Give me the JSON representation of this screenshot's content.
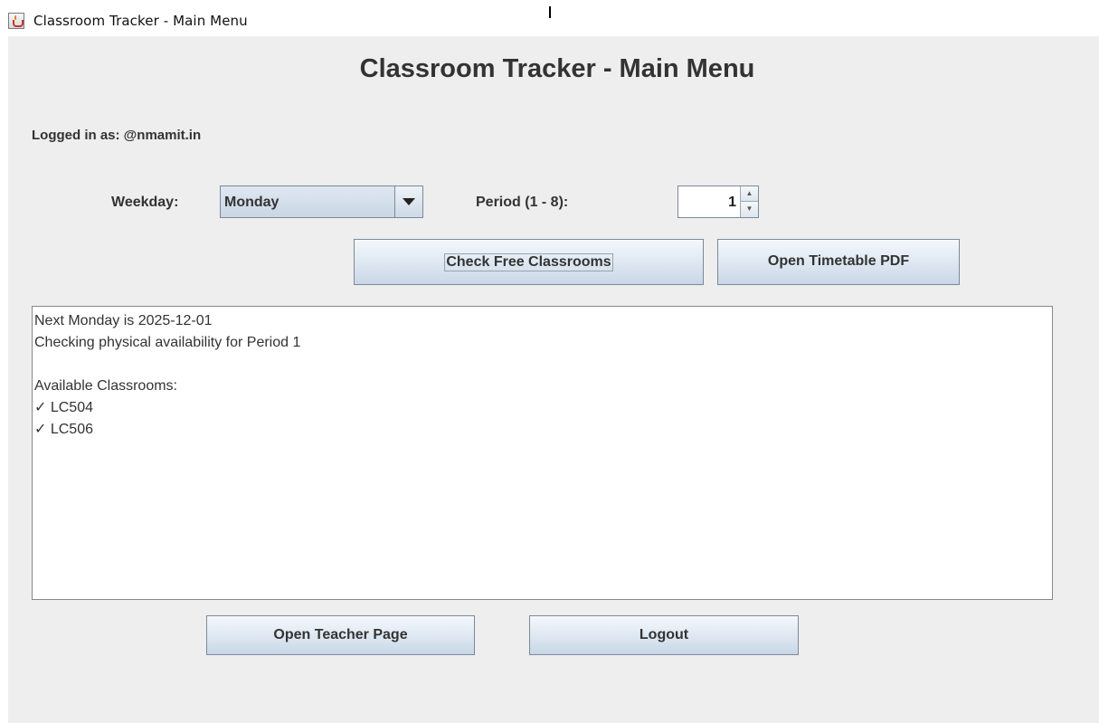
{
  "window": {
    "title": "Classroom Tracker - Main Menu",
    "icon": "java-cup-icon"
  },
  "heading": "Classroom Tracker - Main Menu",
  "user": {
    "logged_in_text": "Logged in as: @nmamit.in"
  },
  "form": {
    "weekday_label": "Weekday:",
    "weekday_value": "Monday",
    "period_label": "Period (1 - 8):",
    "period_value": "1"
  },
  "buttons": {
    "check_free": "Check Free Classrooms",
    "open_pdf": "Open Timetable PDF",
    "open_teacher": "Open Teacher Page",
    "logout": "Logout"
  },
  "output": {
    "lines": [
      "Next Monday is 2025-12-01",
      "Checking physical availability for Period 1",
      "",
      "Available Classrooms:",
      "✓ LC504",
      "✓ LC506"
    ]
  }
}
